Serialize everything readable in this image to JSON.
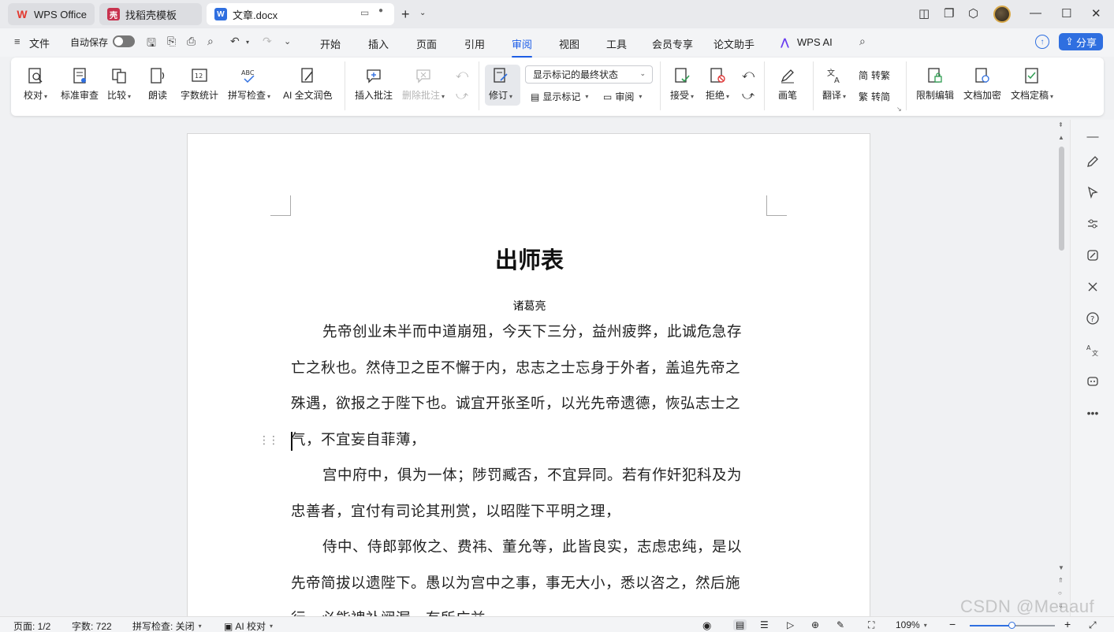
{
  "tabs": [
    {
      "label": "WPS Office"
    },
    {
      "label": "找稻壳模板"
    },
    {
      "label": "文章.docx"
    }
  ],
  "menubar": {
    "file_label": "文件",
    "autosave_label": "自动保存",
    "items": [
      "开始",
      "插入",
      "页面",
      "引用",
      "审阅",
      "视图",
      "工具",
      "会员专享",
      "论文助手",
      "WPS AI"
    ],
    "active_item": "审阅",
    "share_label": "分享"
  },
  "ribbon": {
    "proofread": "校对",
    "standard_review": "标准审查",
    "compare": "比较",
    "read_aloud": "朗读",
    "word_count": "字数统计",
    "spell_check": "拼写检查",
    "ai_polish": "AI 全文润色",
    "insert_comment": "插入批注",
    "delete_comment": "删除批注",
    "revise": "修订",
    "display_mode": "显示标记的最终状态",
    "show_markup": "显示标记",
    "review": "审阅",
    "accept": "接受",
    "reject": "拒绝",
    "pen": "画笔",
    "translate": "翻译",
    "to_traditional": "转繁",
    "to_simplified": "转简",
    "restrict_edit": "限制编辑",
    "encrypt": "文档加密",
    "finalize": "文档定稿"
  },
  "document": {
    "title": "出师表",
    "author": "诸葛亮",
    "paragraphs": [
      [
        "先帝创业未半而中道崩殂，今天下三分，益州疲弊，此诚危急存",
        "亡之秋也。然侍卫之臣不懈于内，忠志之士忘身于外者，盖追先帝之",
        "殊遇，欲报之于陛下也。诚宜开张圣听，以光先帝遗德，恢弘志士之",
        "气，不宜妄自菲薄，"
      ],
      [
        "宫中府中，俱为一体；陟罚臧否，不宜异同。若有作奸犯科及为",
        "忠善者，宜付有司论其刑赏，以昭陛下平明之理，"
      ],
      [
        "侍中、侍郎郭攸之、费祎、董允等，此皆良实，志虑忠纯，是以",
        "先帝简拔以遗陛下。愚以为宫中之事，事无大小，悉以咨之，然后施",
        "行，必能裨补阙漏，有所广益。"
      ]
    ]
  },
  "statusbar": {
    "page": "页面: 1/2",
    "word_count": "字数: 722",
    "spell_check": "拼写检查: 关闭",
    "ai_proofread": "AI 校对",
    "zoom": "109%",
    "zoom_level": 0.5
  },
  "watermark": "CSDN @Meaauf",
  "colors": {
    "accent": "#1e5ee8",
    "share_button": "#2f6fe0",
    "wps_red": "#e3382f"
  }
}
